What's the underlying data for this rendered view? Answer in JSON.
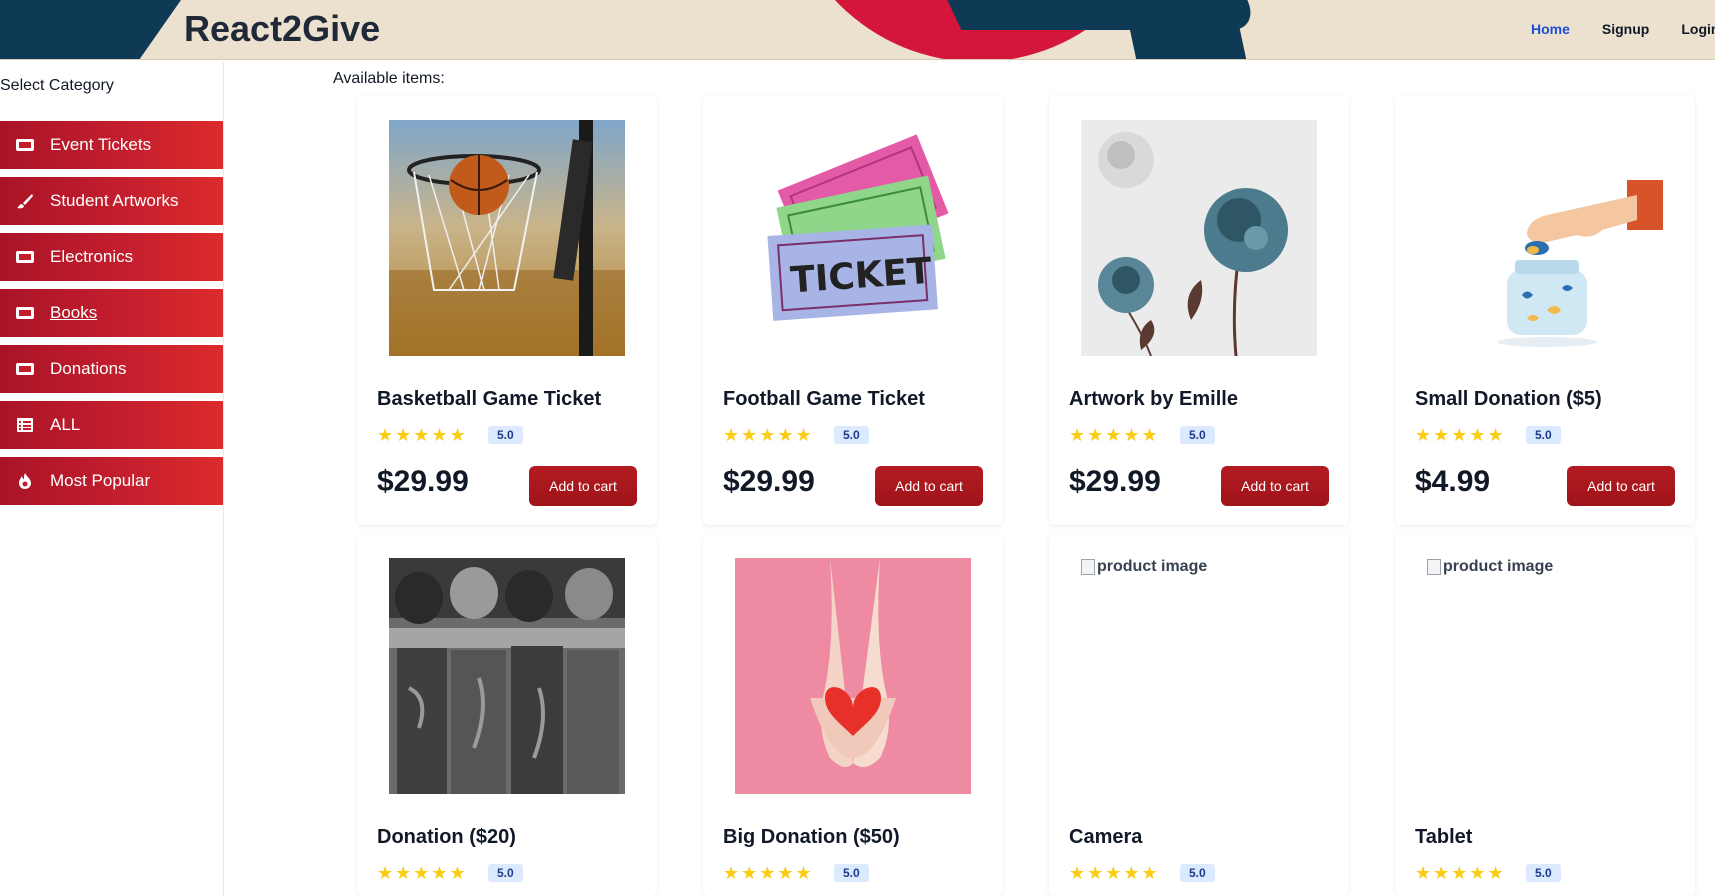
{
  "header": {
    "brand": "React2Give",
    "nav": [
      {
        "label": "Home",
        "active": true
      },
      {
        "label": "Signup",
        "active": false
      },
      {
        "label": "Login",
        "active": false
      }
    ]
  },
  "sidebar": {
    "heading": "Select Category",
    "categories": [
      {
        "label": "Event Tickets",
        "icon": "ticket-icon"
      },
      {
        "label": "Student Artworks",
        "icon": "brush-icon"
      },
      {
        "label": "Electronics",
        "icon": "ticket-icon"
      },
      {
        "label": "Books",
        "icon": "ticket-icon",
        "underlined": true
      },
      {
        "label": "Donations",
        "icon": "ticket-icon"
      },
      {
        "label": "ALL",
        "icon": "list-icon"
      },
      {
        "label": "Most Popular",
        "icon": "fire-icon"
      }
    ]
  },
  "main": {
    "heading": "Available items:",
    "products": [
      {
        "title": "Basketball Game Ticket",
        "rating": "5.0",
        "price": "$29.99",
        "button": "Add to cart",
        "image": "basketball-hoop"
      },
      {
        "title": "Football Game Ticket",
        "rating": "5.0",
        "price": "$29.99",
        "button": "Add to cart",
        "image": "tickets"
      },
      {
        "title": "Artwork by Emille",
        "rating": "5.0",
        "price": "$29.99",
        "button": "Add to cart",
        "image": "flower-artwork"
      },
      {
        "title": "Small Donation ($5)",
        "rating": "5.0",
        "price": "$4.99",
        "button": "Add to cart",
        "image": "donation-jar"
      },
      {
        "title": "Donation ($20)",
        "rating": "5.0",
        "image": "team-huddle"
      },
      {
        "title": "Big Donation ($50)",
        "rating": "5.0",
        "image": "heart-hands"
      },
      {
        "title": "Camera",
        "rating": "5.0",
        "image_alt": "product image"
      },
      {
        "title": "Tablet",
        "rating": "5.0",
        "image_alt": "product image"
      }
    ]
  },
  "colors": {
    "accent_red": "#c41e2e",
    "nav_active": "#1d4ed8",
    "star": "#facc15"
  }
}
